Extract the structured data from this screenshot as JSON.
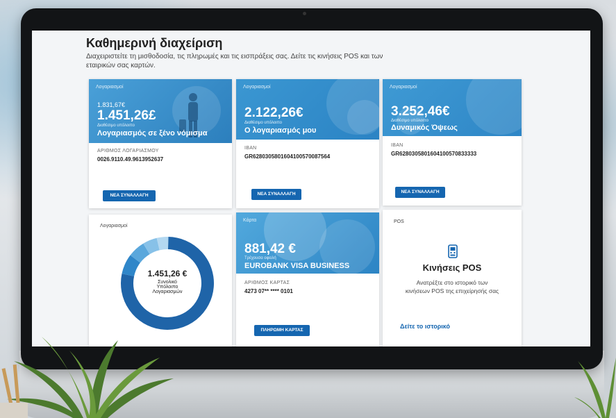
{
  "page": {
    "title": "Καθημερινή διαχείριση",
    "subtitle": "Διαχειριστείτε τη μισθοδοσία, τις πληρωμές και τις εισπράξεις σας. Δείτε τις κινήσεις POS και των εταιρικών σας καρτών."
  },
  "accounts": [
    {
      "tag": "Λογαριασμοί",
      "small_amount": "1.831,67€",
      "amount": "1.451,26£",
      "balance_label": "Διαθέσιμο υπόλοιπο",
      "name": "Λογαριασμός σε ξένο νόμισμα",
      "field_label": "ΑΡΙΘΜΟΣ ΛΟΓΑΡΙΑΣΜΟΥ",
      "field_value": "0026.9110.49.9613952637",
      "button": "ΝΕΑ ΣΥΝΑΛΛΑΓΗ"
    },
    {
      "tag": "Λογαριασμοί",
      "amount": "2.122,26€",
      "balance_label": "Διαθέσιμο υπόλοιπο",
      "name": "Ο λογαριασμός μου",
      "field_label": "IBAN",
      "field_value": "GR6280305801604100570087564",
      "button": "ΝΕΑ ΣΥΝΑΛΛΑΓΗ"
    },
    {
      "tag": "Λογαριασμοί",
      "amount": "3.252,46€",
      "balance_label": "Διαθέσιμο υπόλοιπο",
      "name": "Δυναμικός Όψεως",
      "field_label": "IBAN",
      "field_value": "GR6280305801604100570833333",
      "button": "ΝΕΑ ΣΥΝΑΛΛΑΓΗ"
    }
  ],
  "summary": {
    "tag": "Λογαριασμοί",
    "total": "1.451,26 €",
    "line1": "Συνολικό",
    "line2": "Υπόλοιπο",
    "line3": "Λογαριασμών",
    "segments": [
      {
        "share": 0.78,
        "color": "#1f64a8"
      },
      {
        "share": 0.07,
        "color": "#2f86c9"
      },
      {
        "share": 0.06,
        "color": "#5aa7dc"
      },
      {
        "share": 0.05,
        "color": "#87c1e8"
      },
      {
        "share": 0.04,
        "color": "#b3d8f1"
      }
    ]
  },
  "card": {
    "tag": "Κάρτα",
    "amount": "881,42 €",
    "balance_label": "Τρέχουσα οφειλή",
    "name": "EUROBANK VISA BUSINESS",
    "field_label": "ΑΡΙΘΜΟΣ ΚΑΡΤΑΣ",
    "field_value": "4273 07** **** 0101",
    "button": "ΠΛΗΡΩΜΗ ΚΑΡΤΑΣ"
  },
  "pos": {
    "tag": "POS",
    "icon": "pos-terminal-icon",
    "title": "Κινήσεις POS",
    "desc": "Ανατρέξτε στο ιστορικό των κινήσεων POS της επιχείρησής σας",
    "link": "Δείτε το ιστορικό"
  },
  "colors": {
    "primary": "#1566b0",
    "header_blue": "#3a93cf"
  }
}
